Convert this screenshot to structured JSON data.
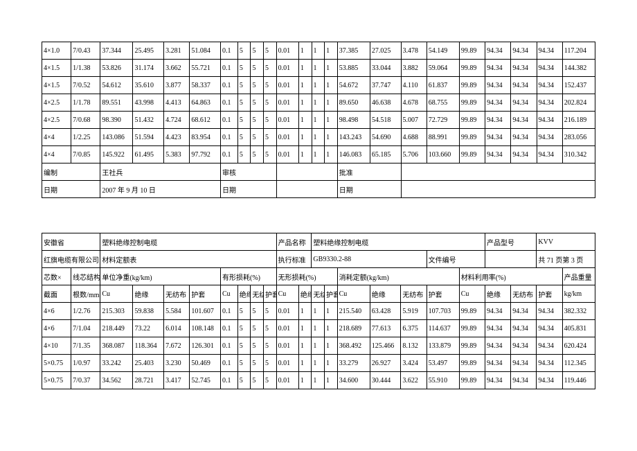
{
  "table1_rows": [
    [
      "4×1.0",
      "7/0.43",
      "37.344",
      "25.495",
      "3.281",
      "51.084",
      "0.1",
      "5",
      "5",
      "5",
      "0.01",
      "1",
      "1",
      "1",
      "37.385",
      "27.025",
      "3.478",
      "54.149",
      "99.89",
      "94.34",
      "94.34",
      "94.34",
      "117.204"
    ],
    [
      "4×1.5",
      "1/1.38",
      "53.826",
      "31.174",
      "3.662",
      "55.721",
      "0.1",
      "5",
      "5",
      "5",
      "0.01",
      "1",
      "1",
      "1",
      "53.885",
      "33.044",
      "3.882",
      "59.064",
      "99.89",
      "94.34",
      "94.34",
      "94.34",
      "144.382"
    ],
    [
      "4×1.5",
      "7/0.52",
      "54.612",
      "35.610",
      "3.877",
      "58.337",
      "0.1",
      "5",
      "5",
      "5",
      "0.01",
      "1",
      "1",
      "1",
      "54.672",
      "37.747",
      "4.110",
      "61.837",
      "99.89",
      "94.34",
      "94.34",
      "94.34",
      "152.437"
    ],
    [
      "4×2.5",
      "1/1.78",
      "89.551",
      "43.998",
      "4.413",
      "64.863",
      "0.1",
      "5",
      "5",
      "5",
      "0.01",
      "1",
      "1",
      "1",
      "89.650",
      "46.638",
      "4.678",
      "68.755",
      "99.89",
      "94.34",
      "94.34",
      "94.34",
      "202.824"
    ],
    [
      "4×2.5",
      "7/0.68",
      "98.390",
      "51.432",
      "4.724",
      "68.612",
      "0.1",
      "5",
      "5",
      "5",
      "0.01",
      "1",
      "1",
      "1",
      "98.498",
      "54.518",
      "5.007",
      "72.729",
      "99.89",
      "94.34",
      "94.34",
      "94.34",
      "216.189"
    ],
    [
      "4×4",
      "1/2.25",
      "143.086",
      "51.594",
      "4.423",
      "83.954",
      "0.1",
      "5",
      "5",
      "5",
      "0.01",
      "1",
      "1",
      "1",
      "143.243",
      "54.690",
      "4.688",
      "88.991",
      "99.89",
      "94.34",
      "94.34",
      "94.34",
      "283.056"
    ],
    [
      "4×4",
      "7/0.85",
      "145.922",
      "61.495",
      "5.383",
      "97.792",
      "0.1",
      "5",
      "5",
      "5",
      "0.01",
      "1",
      "1",
      "1",
      "146.083",
      "65.185",
      "5.706",
      "103.660",
      "99.89",
      "94.34",
      "94.34",
      "94.34",
      "310.342"
    ]
  ],
  "sig": {
    "compile": "编制",
    "compile_by": "王社兵",
    "compile_date_lbl": "日期",
    "compile_date": "2007 年 9 月 10 日",
    "review": "审核",
    "review_date_lbl": "日期",
    "approve": "批准",
    "approve_date_lbl": "日期"
  },
  "hdr": {
    "province": "安徽省",
    "company": "红旗电缆有限公司",
    "title1": "塑料绝缘控制电缆",
    "title2": "材料定额表",
    "prod_name_lbl": "产品名称",
    "prod_name": "塑料绝缘控制电缆",
    "prod_model_lbl": "产品型号",
    "prod_model": "KVV",
    "std_lbl": "执行标准",
    "std": "GB9330.2-88",
    "docno_lbl": "文件编号",
    "page": "共 71 页第 3 页"
  },
  "cols": {
    "cores": "芯数×",
    "section": "截面",
    "struct": "线芯结构",
    "units": "根数/mm",
    "net": "单位净重(kg/km)",
    "tloss": "有形损耗(%)",
    "iloss": "无形损耗(%)",
    "quota": "消耗定额(kg/km)",
    "util": "材料利用率(%)",
    "weight": "产品重量",
    "cu": "Cu",
    "ins": "绝缘",
    "nw": "无纺布",
    "sh": "护套",
    "kgkm": "kg/km"
  },
  "table2_rows": [
    [
      "4×6",
      "1/2.76",
      "215.303",
      "59.838",
      "5.584",
      "101.607",
      "0.1",
      "5",
      "5",
      "5",
      "0.01",
      "1",
      "1",
      "1",
      "215.540",
      "63.428",
      "5.919",
      "107.703",
      "99.89",
      "94.34",
      "94.34",
      "94.34",
      "382.332"
    ],
    [
      "4×6",
      "7/1.04",
      "218.449",
      "73.22",
      "6.014",
      "108.148",
      "0.1",
      "5",
      "5",
      "5",
      "0.01",
      "1",
      "1",
      "1",
      "218.689",
      "77.613",
      "6.375",
      "114.637",
      "99.89",
      "94.34",
      "94.34",
      "94.34",
      "405.831"
    ],
    [
      "4×10",
      "7/1.35",
      "368.087",
      "118.364",
      "7.672",
      "126.301",
      "0.1",
      "5",
      "5",
      "5",
      "0.01",
      "1",
      "1",
      "1",
      "368.492",
      "125.466",
      "8.132",
      "133.879",
      "99.89",
      "94.34",
      "94.34",
      "94.34",
      "620.424"
    ],
    [
      "5×0.75",
      "1/0.97",
      "33.242",
      "25.403",
      "3.230",
      "50.469",
      "0.1",
      "5",
      "5",
      "5",
      "0.01",
      "1",
      "1",
      "1",
      "33.279",
      "26.927",
      "3.424",
      "53.497",
      "99.89",
      "94.34",
      "94.34",
      "94.34",
      "112.345"
    ],
    [
      "5×0.75",
      "7/0.37",
      "34.562",
      "28.721",
      "3.417",
      "52.745",
      "0.1",
      "5",
      "5",
      "5",
      "0.01",
      "1",
      "1",
      "1",
      "34.600",
      "30.444",
      "3.622",
      "55.910",
      "99.89",
      "94.34",
      "94.34",
      "94.34",
      "119.446"
    ]
  ]
}
